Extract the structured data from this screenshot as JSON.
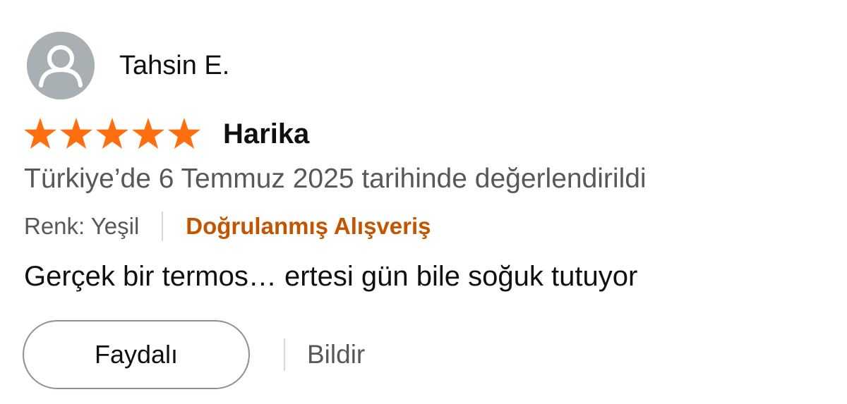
{
  "reviewer": {
    "name": "Tahsin E.",
    "avatar_icon": "default-user-avatar-icon"
  },
  "rating": {
    "stars": 5,
    "max": 5,
    "star_color": "#ff6f0f",
    "star_icon": "filled-star-icon"
  },
  "review": {
    "title": "Harika",
    "date_line": "Türkiye’de 6 Temmuz 2025 tarihinde değerlendirildi",
    "variant": "Renk: Yeşil",
    "verified_label": "Doğrulanmış Alışveriş",
    "body": "Gerçek bir termos… ertesi gün bile soğuk tutuyor"
  },
  "actions": {
    "helpful_label": "Faydalı",
    "report_label": "Bildir"
  },
  "colors": {
    "verified": "#c45500",
    "secondary_text": "#565959",
    "avatar_bg": "#a8b0b3"
  }
}
